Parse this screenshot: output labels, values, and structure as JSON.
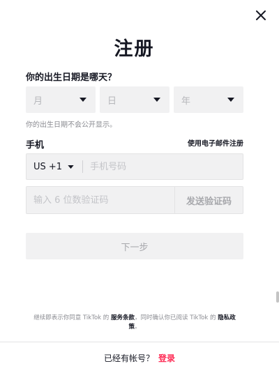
{
  "modal": {
    "title": "注册",
    "close_icon": "close-icon"
  },
  "birthday": {
    "label": "你的出生日期是哪天？",
    "month_placeholder": "月",
    "day_placeholder": "日",
    "year_placeholder": "年",
    "hint": "你的出生日期不会公开显示。"
  },
  "phone": {
    "label": "手机",
    "email_link": "使用电子邮件注册",
    "country_code": "US +1",
    "placeholder": "手机号码"
  },
  "code": {
    "placeholder": "输入 6 位数验证码",
    "send_label": "发送验证码"
  },
  "next_label": "下一步",
  "terms": {
    "prefix": "继续即表示你同意 TikTok 的",
    "terms_link": "服务条款",
    "middle": "，同时确认你已阅读 TikTok 的",
    "privacy_link": "隐私政策",
    "suffix": "。"
  },
  "footer": {
    "question": "已经有帐号？",
    "login_label": "登录"
  },
  "colors": {
    "accent": "#fe2c55",
    "text": "#161823",
    "muted": "#8a8b91",
    "field_bg": "#f1f1f2"
  }
}
